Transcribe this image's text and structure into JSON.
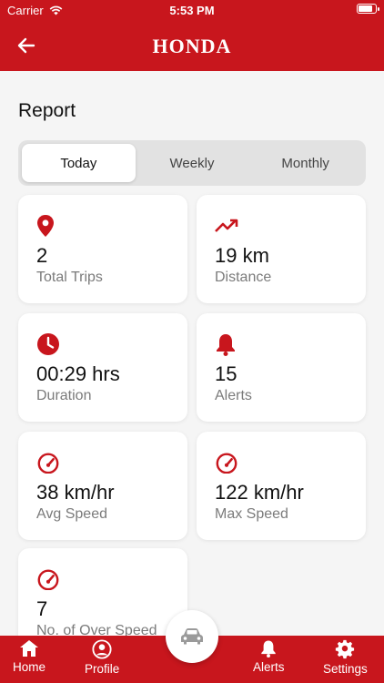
{
  "status_bar": {
    "carrier": "Carrier",
    "time": "5:53 PM"
  },
  "header": {
    "brand": "HONDA"
  },
  "page": {
    "title": "Report"
  },
  "tabs": [
    {
      "label": "Today",
      "active": true
    },
    {
      "label": "Weekly",
      "active": false
    },
    {
      "label": "Monthly",
      "active": false
    }
  ],
  "stats": {
    "trips": {
      "value": "2",
      "label": "Total Trips",
      "icon": "location-pin-icon"
    },
    "distance": {
      "value": "19 km",
      "label": "Distance",
      "icon": "trend-up-icon"
    },
    "duration": {
      "value": "00:29 hrs",
      "label": "Duration",
      "icon": "clock-icon"
    },
    "alerts": {
      "value": "15",
      "label": "Alerts",
      "icon": "bell-icon"
    },
    "avg_speed": {
      "value": "38 km/hr",
      "label": "Avg Speed",
      "icon": "speedometer-icon"
    },
    "max_speed": {
      "value": "122 km/hr",
      "label": "Max Speed",
      "icon": "speedometer-icon"
    },
    "over_speed": {
      "value": "7",
      "label": "No. of Over Speed",
      "icon": "speedometer-icon"
    }
  },
  "bottom_nav": {
    "home": "Home",
    "profile": "Profile",
    "alerts": "Alerts",
    "settings": "Settings"
  },
  "colors": {
    "brand_red": "#c8161d",
    "icon_red": "#c8161d",
    "label_gray": "#7b7b7b"
  }
}
